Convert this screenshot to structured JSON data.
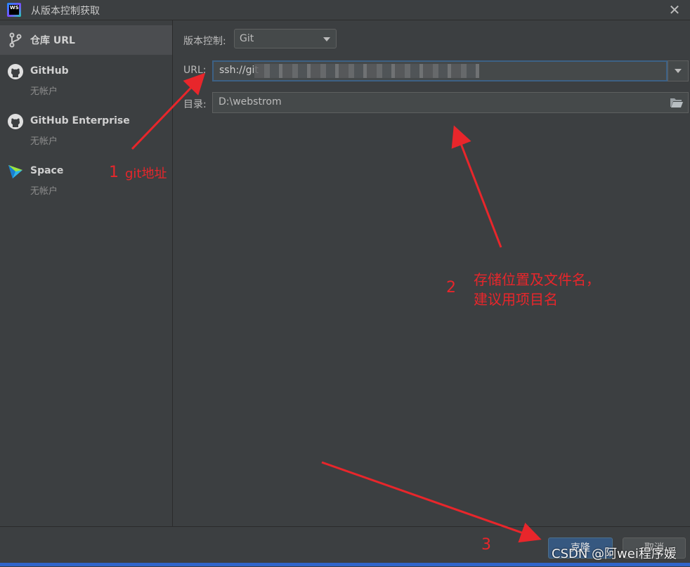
{
  "window": {
    "title": "从版本控制获取",
    "icon_text": "WS"
  },
  "sidebar": {
    "items": [
      {
        "label": "仓库 URL",
        "sublabel": "",
        "icon": "repo-branch-icon"
      },
      {
        "label": "GitHub",
        "sublabel": "无帐户",
        "icon": "github-icon"
      },
      {
        "label": "GitHub Enterprise",
        "sublabel": "无帐户",
        "icon": "github-icon"
      },
      {
        "label": "Space",
        "sublabel": "无帐户",
        "icon": "space-icon"
      }
    ]
  },
  "form": {
    "vcs_label": "版本控制:",
    "vcs_value": "Git",
    "url_label": "URL:",
    "url_value": "ssh://git",
    "dir_label": "目录:",
    "dir_value": "D:\\webstrom"
  },
  "buttons": {
    "clone": "克隆",
    "cancel": "取消"
  },
  "annotations": {
    "a1_num": "1",
    "a1_text": "git地址",
    "a2_num": "2",
    "a2_line1": "存储位置及文件名，",
    "a2_line2": "建议用项目名",
    "a3_num": "3"
  },
  "watermark": "CSDN @阿wei程序媛",
  "colors": {
    "accent": "#365880",
    "annotation": "#e8262b",
    "background": "#3c3f41"
  }
}
